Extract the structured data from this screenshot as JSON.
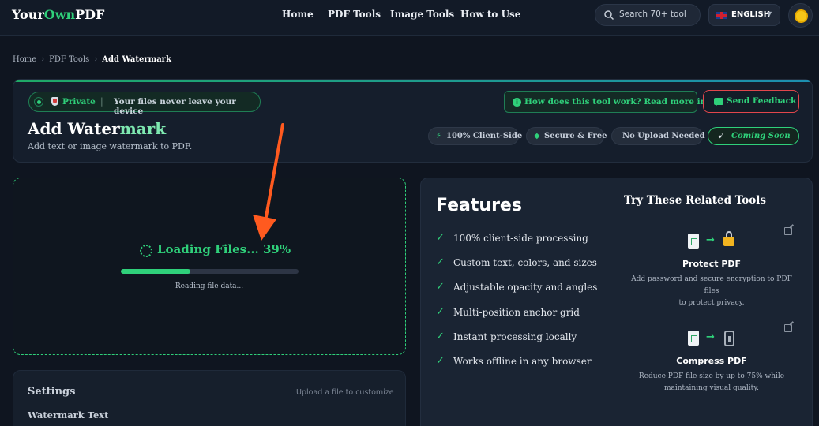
{
  "header": {
    "logo": {
      "part1": "Your",
      "part2": "Own",
      "part3": "PDF"
    },
    "nav": [
      "Home",
      "PDF Tools",
      "Image Tools",
      "How to Use"
    ],
    "search": {
      "placeholder": "Search 70+ tool",
      "icon": "search-icon"
    },
    "language": {
      "label": "ENGLISH",
      "flag": "uk-flag-icon"
    },
    "theme_icon": "sun-icon"
  },
  "breadcrumb": [
    "Home",
    "PDF Tools",
    "Add Watermark"
  ],
  "hero": {
    "privacy_label": "Private",
    "privacy_separator": "|",
    "privacy_desc": "Your files never leave your device",
    "how_button": "How does this tool work? Read more info",
    "feedback_button": "Send Feedback",
    "title_part1": "Add Water",
    "title_part2": "mark",
    "subtitle": "Add text or image watermark to PDF.",
    "tags": [
      "100% Client-Side",
      "Secure & Free",
      "No Upload Needed",
      "Coming Soon"
    ]
  },
  "upload": {
    "status": "Loading Files... 39%",
    "progress": 0.39,
    "detail": "Reading file data..."
  },
  "settings": {
    "title": "Settings",
    "hint": "Upload a file to customize",
    "watermark_label": "Watermark Text"
  },
  "features": {
    "title": "Features",
    "items": [
      "100% client-side processing",
      "Custom text, colors, and sizes",
      "Adjustable opacity and angles",
      "Multi-position anchor grid",
      "Instant processing locally",
      "Works offline in any browser"
    ]
  },
  "related": {
    "title": "Try These Related Tools",
    "tools": [
      {
        "name": "Protect PDF",
        "desc_line1": "Add password and secure encryption to PDF files",
        "desc_line2": "to protect privacy.",
        "icon": "lock-icon"
      },
      {
        "name": "Compress PDF",
        "desc_line1": "Reduce PDF file size by up to 75% while",
        "desc_line2": "maintaining visual quality.",
        "icon": "compress-icon"
      }
    ]
  },
  "colors": {
    "accent": "#2fd07a",
    "background": "#0f1520",
    "annotation": "#ff5a1f"
  }
}
